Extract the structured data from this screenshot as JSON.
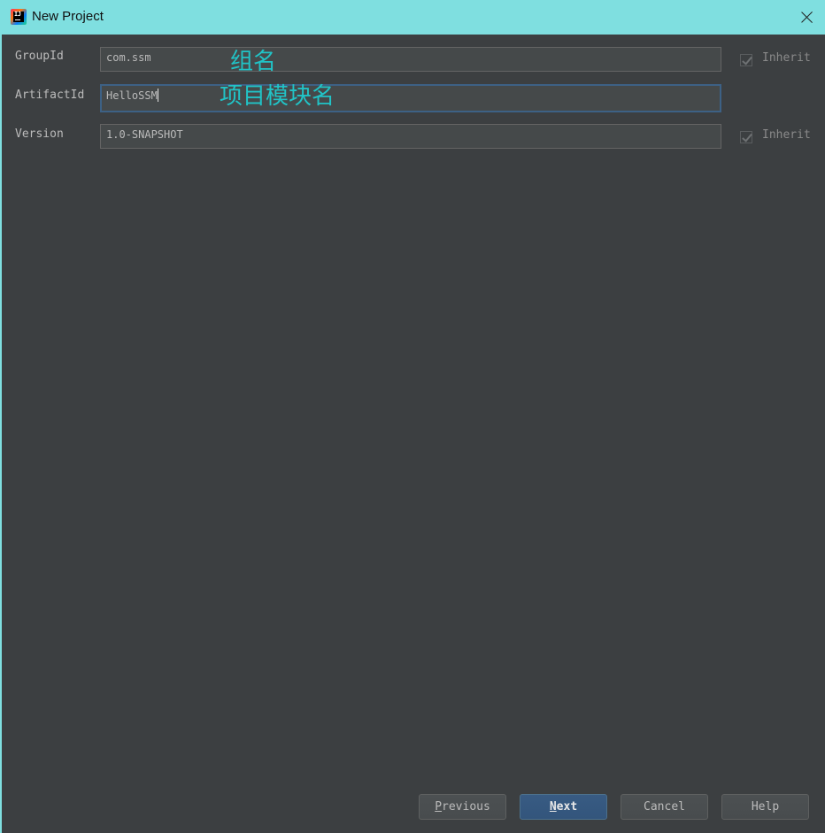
{
  "window": {
    "title": "New Project",
    "app_icon_text": "IJ"
  },
  "form": {
    "group_id": {
      "label": "GroupId",
      "value": "com.ssm",
      "inherit_label": "Inherit",
      "inherit_checked": true
    },
    "artifact_id": {
      "label": "ArtifactId",
      "value": "HelloSSM"
    },
    "version": {
      "label": "Version",
      "value": "1.0-SNAPSHOT",
      "inherit_label": "Inherit",
      "inherit_checked": true
    }
  },
  "annotations": {
    "group": "组名",
    "artifact": "项目模块名"
  },
  "buttons": {
    "previous": {
      "mnemonic": "P",
      "rest": "revious"
    },
    "next": {
      "mnemonic": "N",
      "rest": "ext"
    },
    "cancel": "Cancel",
    "help": "Help"
  },
  "colors": {
    "titlebar": "#7fdfe0",
    "background": "#3c3f41",
    "annotation": "#21c3c6",
    "primary_button": "#365880"
  }
}
